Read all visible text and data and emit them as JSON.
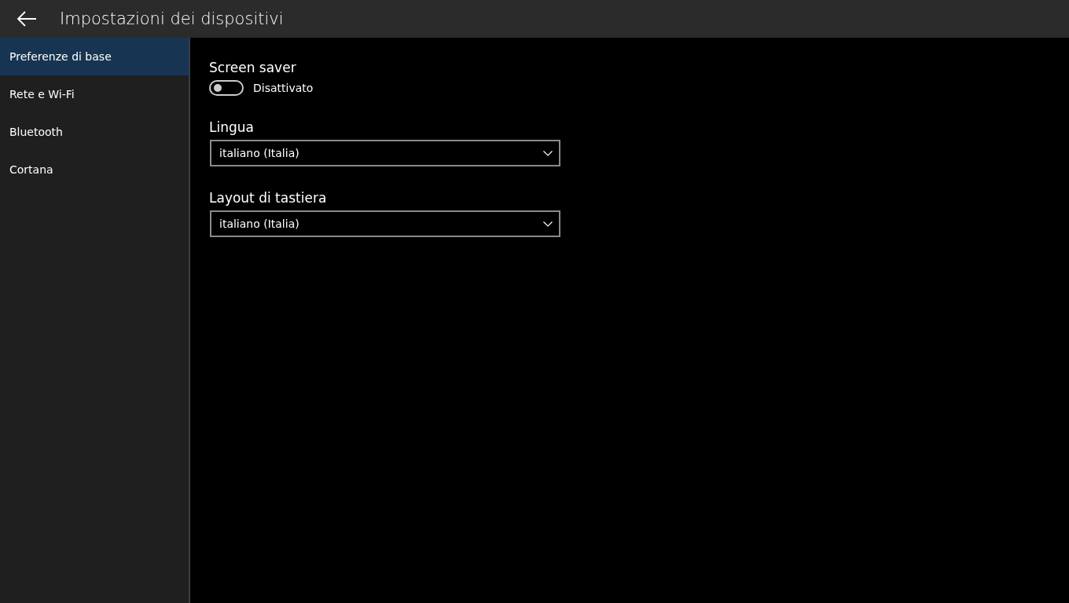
{
  "header": {
    "title": "Impostazioni dei dispositivi"
  },
  "sidebar": {
    "items": [
      {
        "label": "Preferenze di base",
        "selected": true
      },
      {
        "label": "Rete e Wi-Fi",
        "selected": false
      },
      {
        "label": "Bluetooth",
        "selected": false
      },
      {
        "label": "Cortana",
        "selected": false
      }
    ]
  },
  "settings": [
    {
      "kind": "toggle",
      "label": "Screen saver",
      "on": false,
      "state_text": "Disattivato"
    },
    {
      "kind": "dropdown",
      "label": "Lingua",
      "value": "italiano (Italia)"
    },
    {
      "kind": "dropdown",
      "label": "Layout di tastiera",
      "value": "italiano (Italia)"
    }
  ]
}
